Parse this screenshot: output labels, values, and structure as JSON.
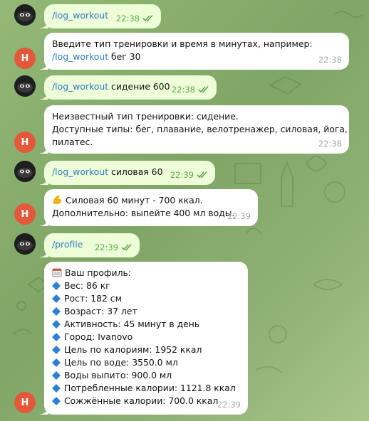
{
  "colors": {
    "outgoing_bubble": "#eefed8",
    "incoming_bubble": "#ffffff",
    "link": "#2c7cc4",
    "time_out": "#5bab46",
    "time_in": "#a3a8ad",
    "user_avatar": "#e4583a",
    "info_bullet": "#2e7fd8"
  },
  "user_initial": "Н",
  "messages": [
    {
      "from": "bot-avatar",
      "kind": "out",
      "command": "/log_workout",
      "text": "",
      "time": "22:38",
      "status": "read"
    },
    {
      "from": "user-avatar",
      "kind": "in",
      "lines": [
        "Введите тип тренировки и время в минутах, например:"
      ],
      "line2_command": "/log_workout",
      "line2_text": " бег 30",
      "time": "22:38"
    },
    {
      "from": "bot-avatar",
      "kind": "out",
      "command": "/log_workout",
      "text": " сидение 600",
      "time": "22:38",
      "status": "read"
    },
    {
      "from": "user-avatar",
      "kind": "in",
      "lines": [
        "Неизвестный тип тренировки: сидение.",
        "Доступные типы: бег, плавание, велотренажер, силовая, йога,",
        "пилатес."
      ],
      "time": "22:38"
    },
    {
      "from": "bot-avatar",
      "kind": "out",
      "command": "/log_workout",
      "text": " силовая 60",
      "time": "22:39",
      "status": "read"
    },
    {
      "from": "user-avatar",
      "kind": "in",
      "lines": [
        "Силовая 60 минут - 700 ккал.",
        "Дополнительно: выпейте 400 мл воды."
      ],
      "emoji": "flexed-biceps-icon",
      "time": "22:39"
    },
    {
      "from": "bot-avatar",
      "kind": "out",
      "command": "/profile",
      "text": "",
      "time": "22:39",
      "status": "read"
    },
    {
      "from": "user-avatar",
      "kind": "in",
      "title": "Ваш профиль:",
      "title_icon": "calendar-icon",
      "bullet_icon": "blue-diamond-icon",
      "items": [
        "Вес: 86 кг",
        "Рост: 182 см",
        "Возраст: 37 лет",
        "Активность: 45 минут в день",
        "Город: Ivanovo",
        "Цель по калориям: 1952 ккал",
        "Цель по воде: 3550.0 мл",
        "Воды выпито: 900.0 мл",
        "Потребленные калории: 1121.8 ккал",
        "Сожжённые калории: 700.0 ккал"
      ],
      "time": "22:39"
    }
  ]
}
